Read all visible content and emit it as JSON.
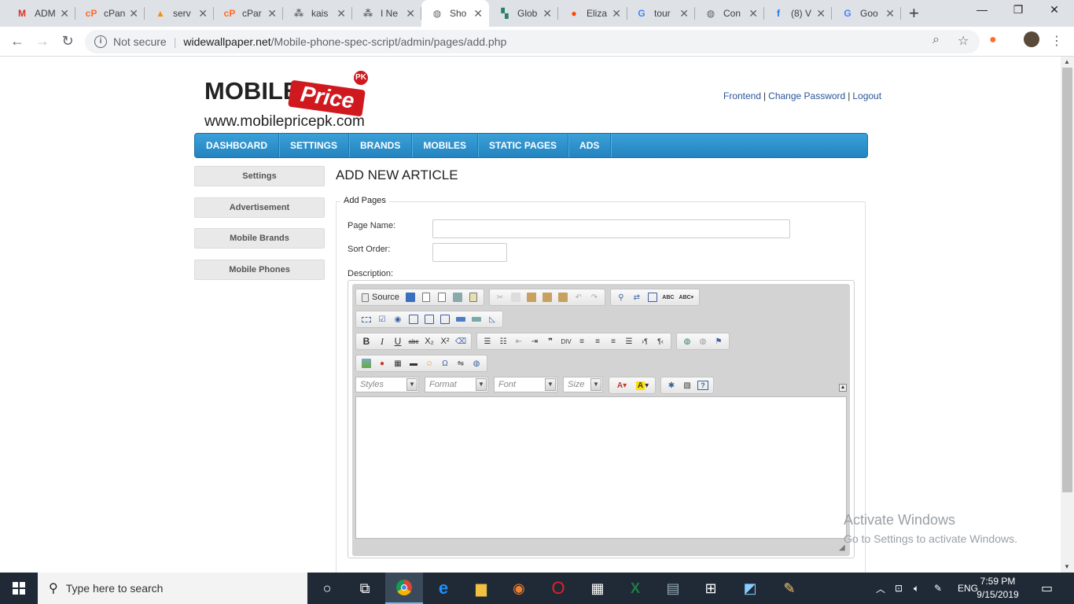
{
  "browser": {
    "tabs": [
      {
        "title": "ADM",
        "favicon": "gmail-icon",
        "color": "#d93025",
        "glyph": "M"
      },
      {
        "title": "cPan",
        "favicon": "cpanel-icon",
        "color": "#ff6c2c",
        "glyph": "cP"
      },
      {
        "title": "serv",
        "favicon": "phpmyadmin-icon",
        "color": "#f29111",
        "glyph": "▲"
      },
      {
        "title": "cPar",
        "favicon": "cpanel-icon",
        "color": "#ff6c2c",
        "glyph": "cP"
      },
      {
        "title": "kais",
        "favicon": "network-icon",
        "color": "#5f6368",
        "glyph": "⁂"
      },
      {
        "title": "I Ne",
        "favicon": "network-icon",
        "color": "#5f6368",
        "glyph": "⁂"
      },
      {
        "title": "Sho",
        "favicon": "globe-icon",
        "color": "#5f6368",
        "glyph": "◍",
        "active": true
      },
      {
        "title": "Glob",
        "favicon": "map-icon",
        "color": "#2a7f62",
        "glyph": "▚"
      },
      {
        "title": "Eliza",
        "favicon": "reddit-icon",
        "color": "#ff4500",
        "glyph": "●"
      },
      {
        "title": "tour",
        "favicon": "google-icon",
        "color": "#4285f4",
        "glyph": "G"
      },
      {
        "title": "Con",
        "favicon": "globe-icon",
        "color": "#5f6368",
        "glyph": "◍"
      },
      {
        "title": "(8) V",
        "favicon": "facebook-icon",
        "color": "#1877f2",
        "glyph": "f"
      },
      {
        "title": "Goo",
        "favicon": "google-icon",
        "color": "#4285f4",
        "glyph": "G"
      }
    ],
    "new_tab": "+",
    "address": {
      "security": "Not secure",
      "host": "widewallpaper.net",
      "path": "/Mobile-phone-spec-script/admin/pages/add.php"
    }
  },
  "site": {
    "logo_word": "MOBILE",
    "logo_price": "Price",
    "logo_badge": "PK",
    "logo_url": "www.mobilepricepk.com",
    "top_links": {
      "frontend": "Frontend",
      "change_password": "Change Password",
      "logout": "Logout"
    },
    "nav": [
      "DASHBOARD",
      "SETTINGS",
      "BRANDS",
      "MOBILES",
      "STATIC PAGES",
      "ADS"
    ],
    "sidebar": [
      "Settings",
      "Advertisement",
      "Mobile Brands",
      "Mobile Phones"
    ],
    "page_title": "ADD NEW ARTICLE",
    "form": {
      "legend": "Add Pages",
      "page_name_label": "Page Name:",
      "page_name_value": "",
      "sort_order_label": "Sort Order:",
      "sort_order_value": "",
      "description_label": "Description:"
    },
    "editor": {
      "source_label": "Source",
      "styles": "Styles",
      "format": "Format",
      "font": "Font",
      "size": "Size"
    }
  },
  "watermark": {
    "title": "Activate Windows",
    "subtitle": "Go to Settings to activate Windows."
  },
  "taskbar": {
    "search_placeholder": "Type here to search",
    "language": "ENG",
    "time": "7:59 PM",
    "date": "9/15/2019"
  },
  "colors": {
    "nav_blue": "#2484c0",
    "link_blue": "#2a5599",
    "logo_red": "#d0191f"
  }
}
